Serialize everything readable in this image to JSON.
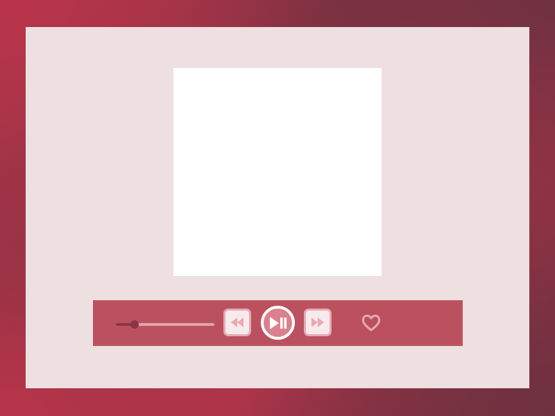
{
  "player": {
    "artwork": "blank-album-art",
    "progress_fraction": 0.19,
    "controls": {
      "rewind_icon": "rewind-icon",
      "play_pause_icon": "play-pause-icon",
      "forward_icon": "fast-forward-icon",
      "favorite_icon": "heart-icon"
    }
  },
  "colors": {
    "panel": "#eedfe0",
    "control_bar": "#bb515f",
    "accent_dark": "#8c3445",
    "accent_light": "#e8a9b2",
    "play_button": "#d9828e"
  }
}
